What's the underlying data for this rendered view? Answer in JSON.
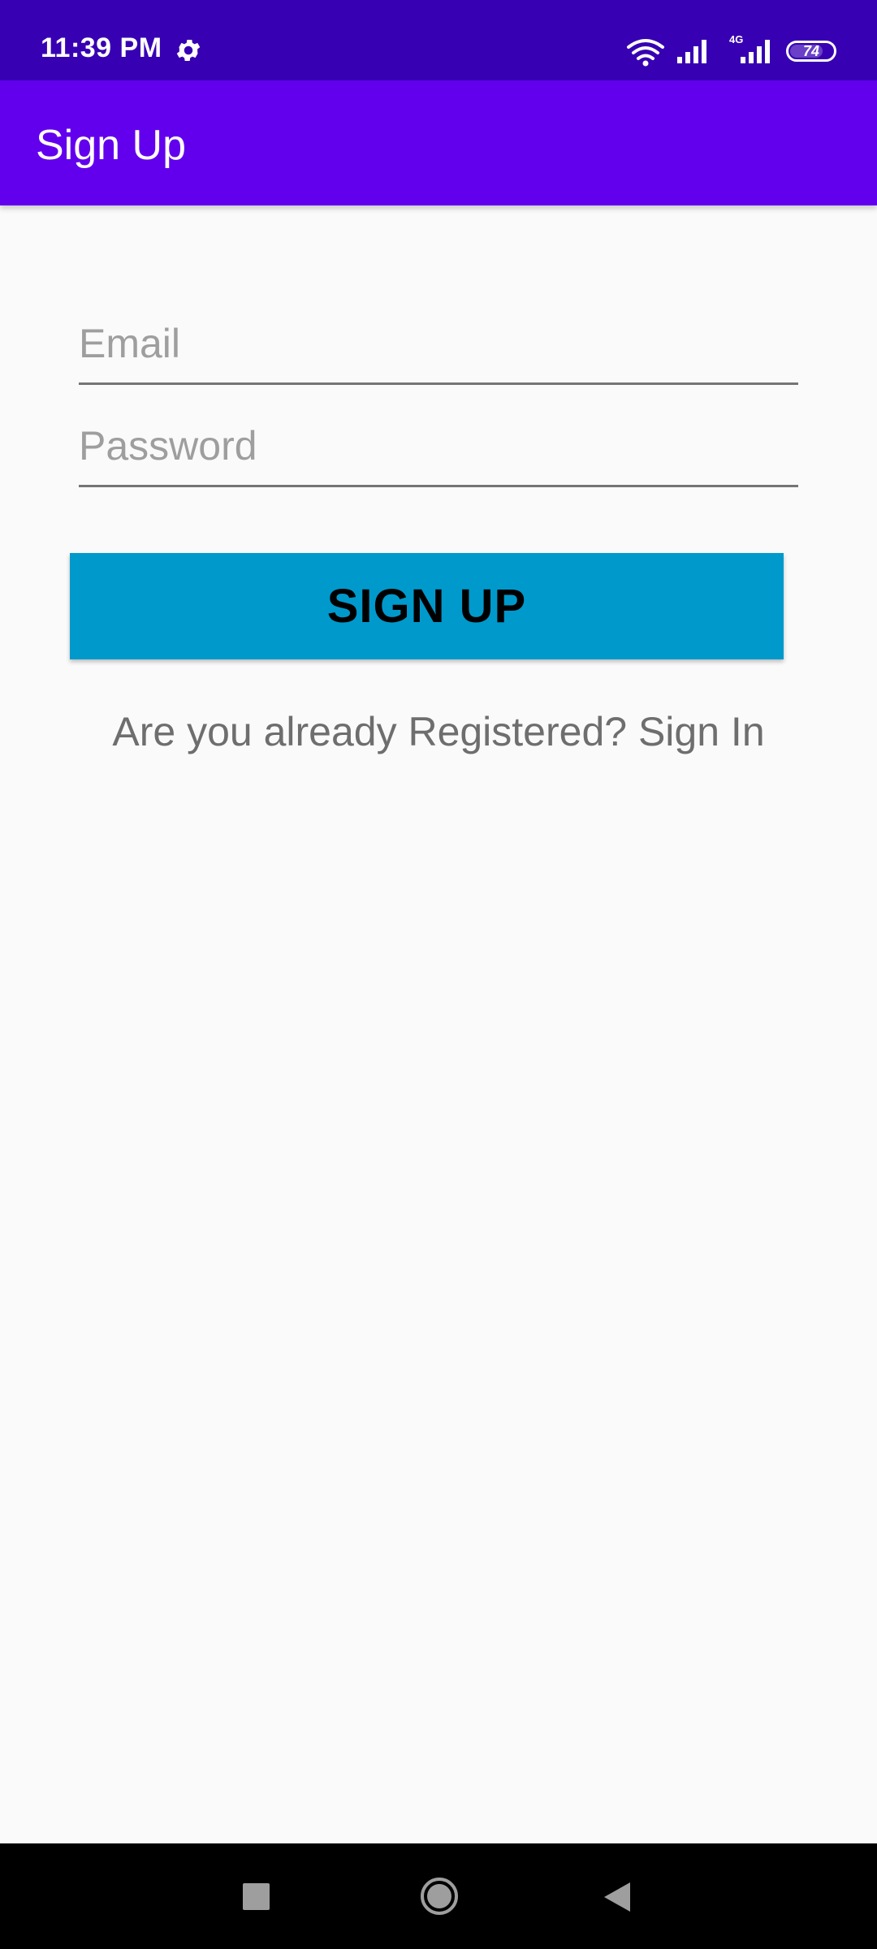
{
  "status_bar": {
    "time": "11:39 PM",
    "network_label": "4G",
    "battery": "74",
    "icons": [
      "gear-icon",
      "wifi-icon",
      "signal-icon",
      "signal-4g-icon",
      "battery-icon"
    ]
  },
  "app_bar": {
    "title": "Sign Up"
  },
  "form": {
    "email": {
      "value": "",
      "placeholder": "Email"
    },
    "password": {
      "value": "",
      "placeholder": "Password"
    },
    "signup_label": "SIGN UP",
    "signin_prompt": "Are you already Registered? Sign In"
  },
  "colors": {
    "status_bar": "#3700b3",
    "app_bar": "#6200ee",
    "button": "#0099cc",
    "background": "#fafafa"
  },
  "nav_bar": {
    "icons": [
      "recent-apps-icon",
      "home-icon",
      "back-icon"
    ]
  }
}
